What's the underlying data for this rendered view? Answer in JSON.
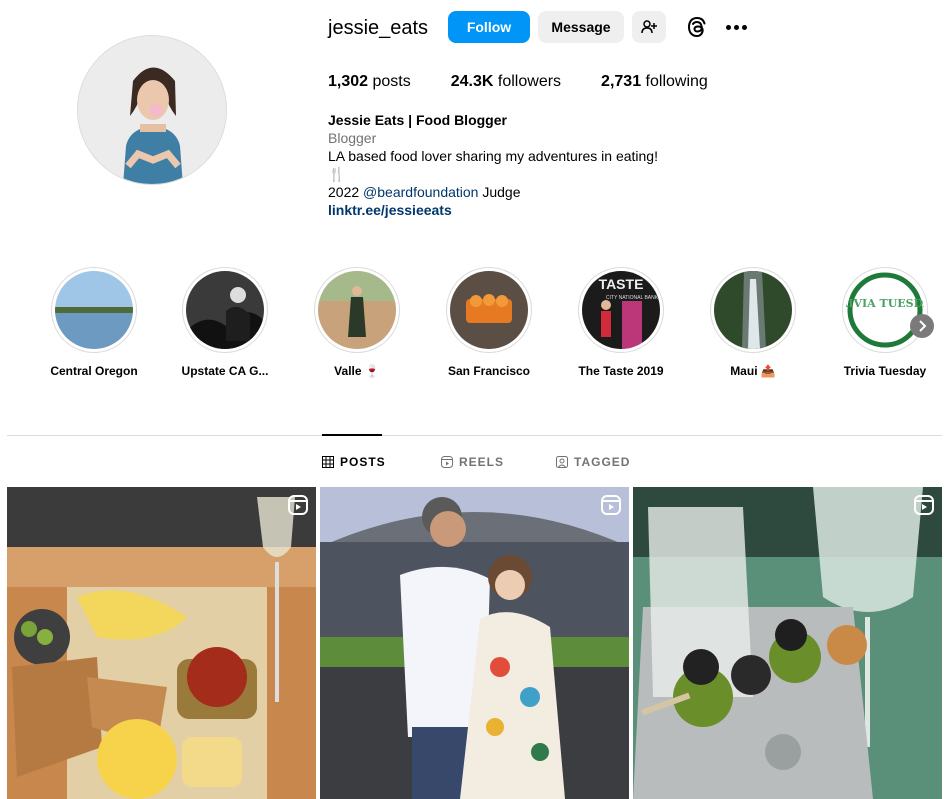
{
  "profile": {
    "username": "jessie_eats",
    "follow_label": "Follow",
    "message_label": "Message",
    "posts_count": "1,302",
    "posts_label": "posts",
    "followers_count": "24.3K",
    "followers_label": "followers",
    "following_count": "2,731",
    "following_label": "following",
    "display_name": "Jessie Eats | Food Blogger",
    "category": "Blogger",
    "bio_line1": "LA based food lover sharing my adventures in eating!",
    "bio_line2": "🍴",
    "bio_line3_prefix": "2022 ",
    "bio_line3_mention": "@beardfoundation",
    "bio_line3_suffix": " Judge",
    "link": "linktr.ee/jessieeats"
  },
  "highlights": [
    {
      "label": "Central Oregon"
    },
    {
      "label": "Upstate CA G..."
    },
    {
      "label": "Valle 🍷"
    },
    {
      "label": "San Francisco"
    },
    {
      "label": "The Taste 2019"
    },
    {
      "label": "Maui 📤"
    },
    {
      "label": "Trivia Tuesday"
    }
  ],
  "highlight_images": {
    "trivia_text": "TRIVIA TUESDAY",
    "taste_text": "TASTE",
    "taste_sub": "CITY NATIONAL BANK"
  },
  "tabs": [
    {
      "label": "POSTS"
    },
    {
      "label": "REELS"
    },
    {
      "label": "TAGGED"
    }
  ],
  "colors": {
    "accent": "#0095f6",
    "secondary_button": "#efefef",
    "link": "#00376b",
    "muted": "#737373"
  }
}
